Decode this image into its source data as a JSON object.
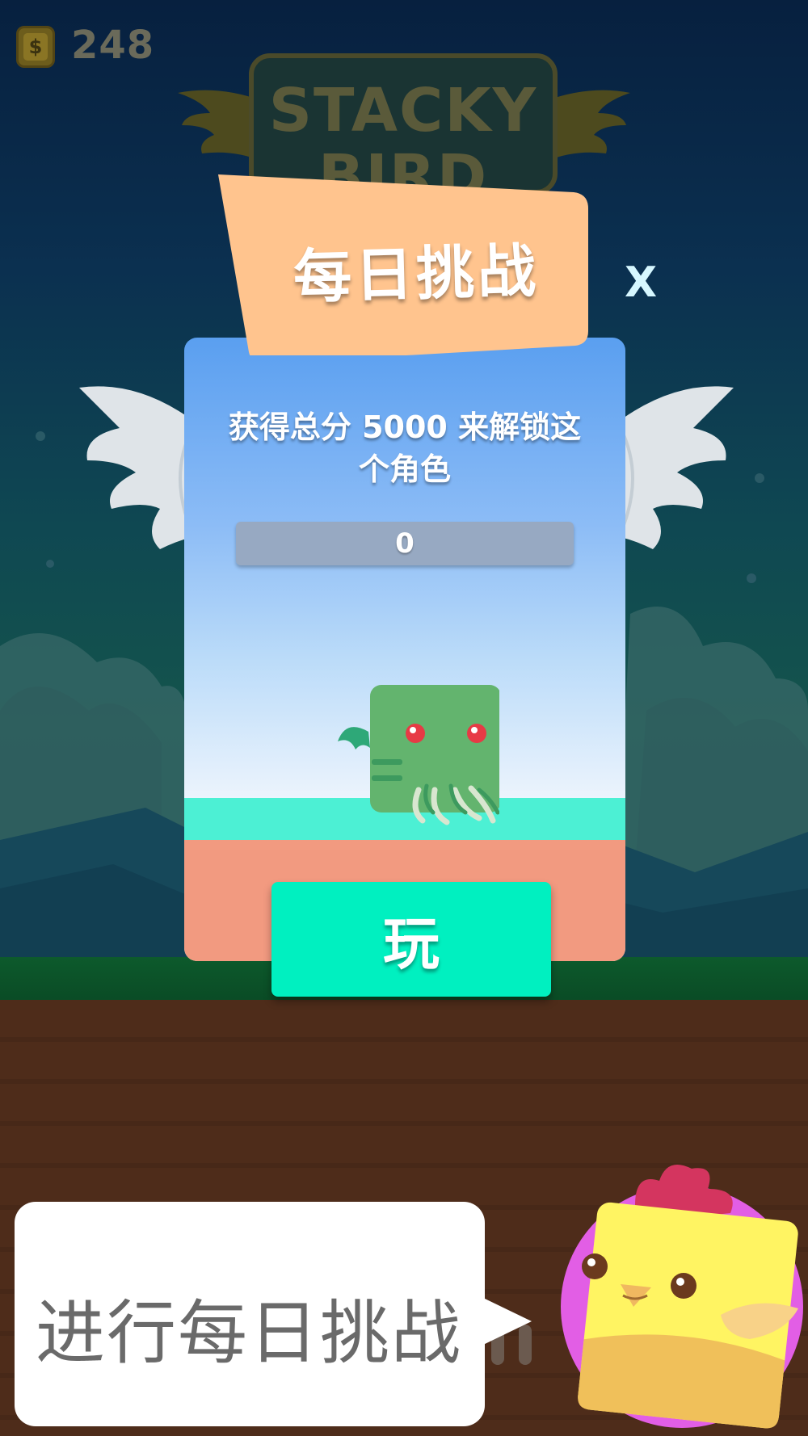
{
  "hud": {
    "coin_symbol": "$",
    "coins": "248"
  },
  "logo": {
    "line1": "STACKY",
    "line2": "BIRD"
  },
  "dialog": {
    "title": "每日挑战",
    "close_label": "X",
    "goal_text": "获得总分 5000 来解锁这个角色",
    "progress_value": "0",
    "progress_fraction": 0,
    "play_label": "玩"
  },
  "tutorial": {
    "text": "进行每日挑战"
  },
  "colors": {
    "card_top": "#5a9ff0",
    "ground_top": "#4cf0d4",
    "ground_bottom": "#f29a80",
    "play_button": "#00f0c0",
    "title_tag": "#ffc48e",
    "mascot_bg": "#e25ee5",
    "mascot_body": "#fff462"
  },
  "icons": {
    "coin": "coin-icon",
    "close": "close-icon",
    "character": "cthulhu-bird-character",
    "mascot": "chick-mascot"
  }
}
